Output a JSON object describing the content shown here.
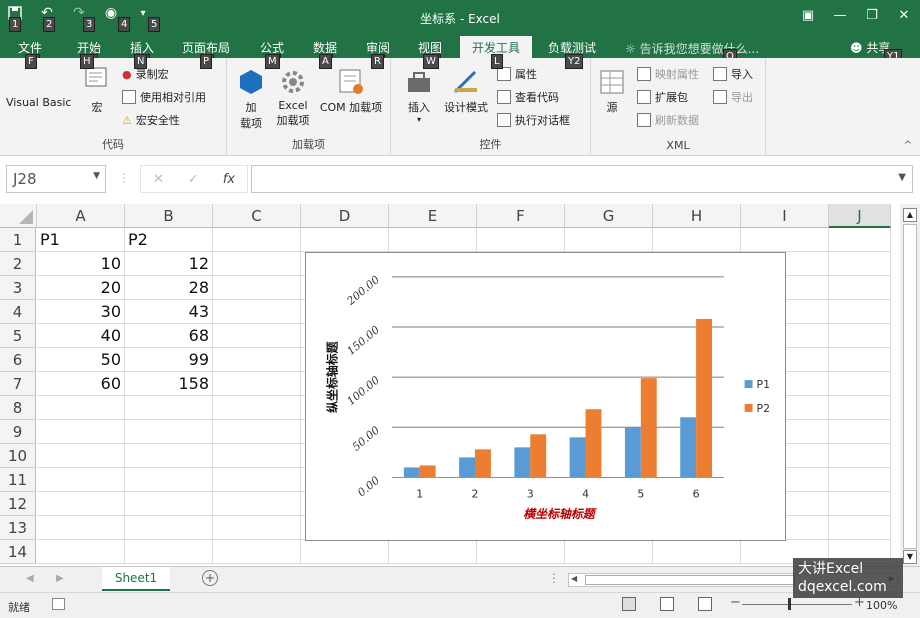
{
  "window": {
    "title": "坐标系 - Excel"
  },
  "qat": {
    "keytips": [
      "1",
      "2",
      "3",
      "4",
      "5"
    ]
  },
  "tabs": [
    {
      "label": "文件",
      "keytip": "F"
    },
    {
      "label": "开始",
      "keytip": "H"
    },
    {
      "label": "插入",
      "keytip": "N"
    },
    {
      "label": "页面布局",
      "keytip": "P"
    },
    {
      "label": "公式",
      "keytip": "M"
    },
    {
      "label": "数据",
      "keytip": "A"
    },
    {
      "label": "审阅",
      "keytip": "R"
    },
    {
      "label": "视图",
      "keytip": "W"
    },
    {
      "label": "开发工具",
      "keytip": "L"
    },
    {
      "label": "负载测试",
      "keytip": "Y2"
    }
  ],
  "tell_me": "告诉我您想要做什么...",
  "tell_me_keytip": "Q",
  "share": {
    "label": "共享",
    "keytip": "Y1"
  },
  "ribbon": {
    "code": {
      "label": "代码",
      "visual_basic": "Visual Basic",
      "macros": "宏",
      "record_macro": "录制宏",
      "relative_ref": "使用相对引用",
      "macro_security": "宏安全性"
    },
    "addins": {
      "label": "加载项",
      "addins_line1": "加",
      "addins_line2": "载项",
      "excel_addins_line1": "Excel",
      "excel_addins_line2": "加载项",
      "com_addins": "COM 加载项"
    },
    "controls": {
      "label": "控件",
      "insert": "插入",
      "design_mode": "设计模式",
      "properties": "属性",
      "view_code": "查看代码",
      "run_dialog": "执行对话框"
    },
    "xml": {
      "label": "XML",
      "source": "源",
      "map_props": "映射属性",
      "expansion_packs": "扩展包",
      "refresh_data": "刷新数据",
      "import": "导入",
      "export": "导出"
    }
  },
  "formula_bar": {
    "name_box": "J28",
    "fx": "fx",
    "formula": ""
  },
  "columns": [
    "A",
    "B",
    "C",
    "D",
    "E",
    "F",
    "G",
    "H",
    "I",
    "J"
  ],
  "rows": [
    "1",
    "2",
    "3",
    "4",
    "5",
    "6",
    "7",
    "8",
    "9",
    "10",
    "11",
    "12",
    "13",
    "14"
  ],
  "cells": {
    "A1": "P1",
    "B1": "P2",
    "A2": "10",
    "B2": "12",
    "A3": "20",
    "B3": "28",
    "A4": "30",
    "B4": "43",
    "A5": "40",
    "B5": "68",
    "A6": "50",
    "B6": "99",
    "A7": "60",
    "B7": "158"
  },
  "chart_data": {
    "type": "bar",
    "categories": [
      "1",
      "2",
      "3",
      "4",
      "5",
      "6"
    ],
    "series": [
      {
        "name": "P1",
        "values": [
          10,
          20,
          30,
          40,
          50,
          60
        ],
        "color": "#5b9bd5"
      },
      {
        "name": "P2",
        "values": [
          12,
          28,
          43,
          68,
          99,
          158
        ],
        "color": "#ed7d31"
      }
    ],
    "yticks": [
      "0.00",
      "50.00",
      "100.00",
      "150.00",
      "200.00"
    ],
    "ylim": [
      0,
      200
    ],
    "xlabel": "横坐标轴标题",
    "ylabel": "纵坐标轴标题",
    "xlabel_color": "#c00000",
    "legend": "right",
    "grid": true
  },
  "sheets": {
    "active": "Sheet1"
  },
  "status": {
    "ready": "就绪",
    "zoom": "100%"
  },
  "watermark": {
    "line1": "大讲Excel",
    "line2": "dqexcel.com"
  },
  "colors": {
    "accent": "#217346"
  }
}
